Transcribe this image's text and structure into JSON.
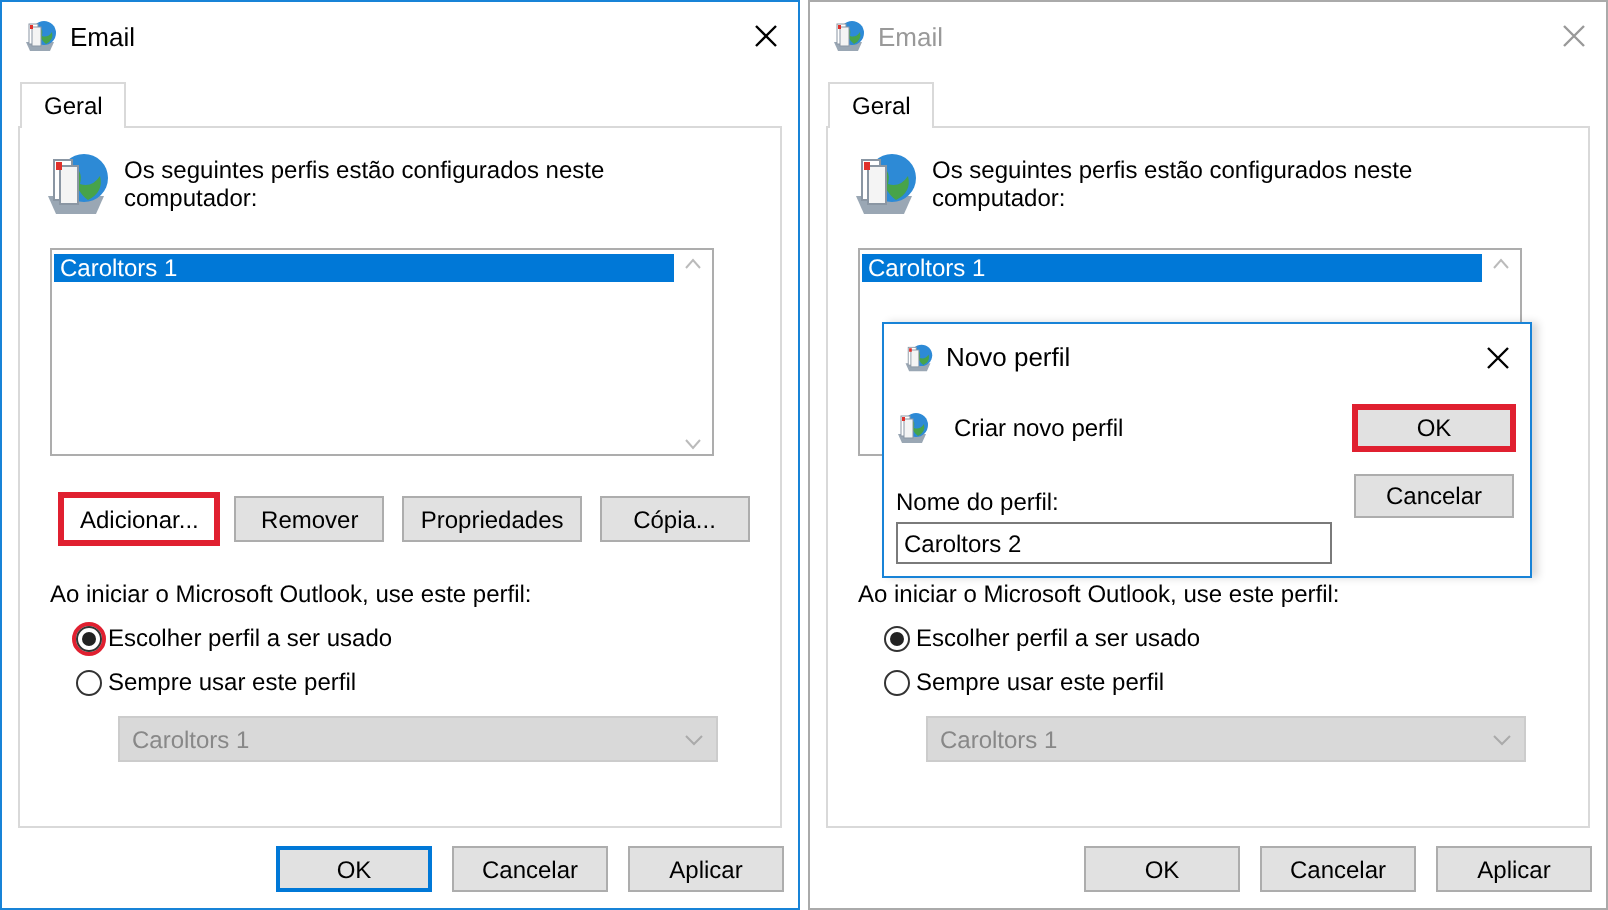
{
  "windows": [
    {
      "title": "Email",
      "active": true,
      "tab": {
        "label": "Geral",
        "selected": true
      },
      "intro": "Os seguintes perfis estão configurados neste computador:",
      "profiles": [
        {
          "label": "Caroltors 1",
          "selected": true
        }
      ],
      "buttons": [
        {
          "label": "Adicionar...",
          "highlighted": true
        },
        {
          "label": "Remover",
          "highlighted": false
        },
        {
          "label": "Propriedades",
          "highlighted": false
        },
        {
          "label": "Cópia...",
          "highlighted": false
        }
      ],
      "startup_label": "Ao iniciar o Microsoft Outlook, use este perfil:",
      "options": [
        {
          "label": "Escolher perfil a ser usado",
          "selected": true,
          "highlighted": true
        },
        {
          "label": "Sempre usar este perfil",
          "selected": false,
          "highlighted": false
        }
      ],
      "dropdown": {
        "value": "Caroltors 1",
        "disabled": true
      },
      "footer_buttons": [
        {
          "label": "OK",
          "default": true
        },
        {
          "label": "Cancelar",
          "default": false
        },
        {
          "label": "Aplicar",
          "default": false
        }
      ]
    },
    {
      "title": "Email",
      "active": false,
      "tab": {
        "label": "Geral",
        "selected": true
      },
      "intro": "Os seguintes perfis estão configurados neste computador:",
      "profiles": [
        {
          "label": "Caroltors 1",
          "selected": true
        }
      ],
      "startup_label": "Ao iniciar o Microsoft Outlook, use este perfil:",
      "options": [
        {
          "label": "Escolher perfil a ser usado",
          "selected": true,
          "highlighted": false
        },
        {
          "label": "Sempre usar este perfil",
          "selected": false,
          "highlighted": false
        }
      ],
      "dropdown": {
        "value": "Caroltors 1",
        "disabled": true
      },
      "footer_buttons": [
        {
          "label": "OK",
          "default": false
        },
        {
          "label": "Cancelar",
          "default": false
        },
        {
          "label": "Aplicar",
          "default": false
        }
      ]
    }
  ],
  "modal": {
    "title": "Novo perfil",
    "heading": "Criar novo perfil",
    "field_label": "Nome do perfil:",
    "field_value": "Caroltors 2",
    "buttons": [
      {
        "label": "OK",
        "highlighted": true
      },
      {
        "label": "Cancelar",
        "highlighted": false
      }
    ]
  }
}
